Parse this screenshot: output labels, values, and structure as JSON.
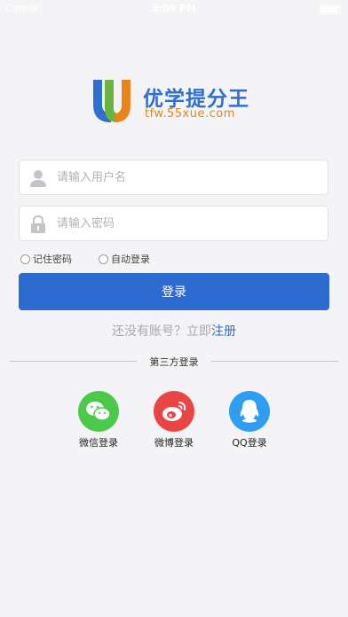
{
  "status_bar": {
    "carrier": "Carrier",
    "time": "3:09 PM"
  },
  "logo": {
    "title": "优学提分王",
    "url": "tfw.55xue.com"
  },
  "form": {
    "username_placeholder": "请输入用户名",
    "password_placeholder": "请输入密码",
    "remember_password": "记住密码",
    "auto_login": "自动登录",
    "login_button": "登录"
  },
  "register": {
    "prompt": "还没有账号？立即",
    "link": "注册"
  },
  "third_party": {
    "heading": "第三方登录",
    "items": [
      {
        "label": "微信登录",
        "icon": "wechat-icon",
        "color": "#4cc94c"
      },
      {
        "label": "微博登录",
        "icon": "weibo-icon",
        "color": "#e94545"
      },
      {
        "label": "QQ登录",
        "icon": "qq-icon",
        "color": "#2f9ef0"
      }
    ]
  },
  "colors": {
    "primary": "#2d6bd1",
    "background": "#f4f4f6",
    "logo_orange": "#e8841a"
  }
}
